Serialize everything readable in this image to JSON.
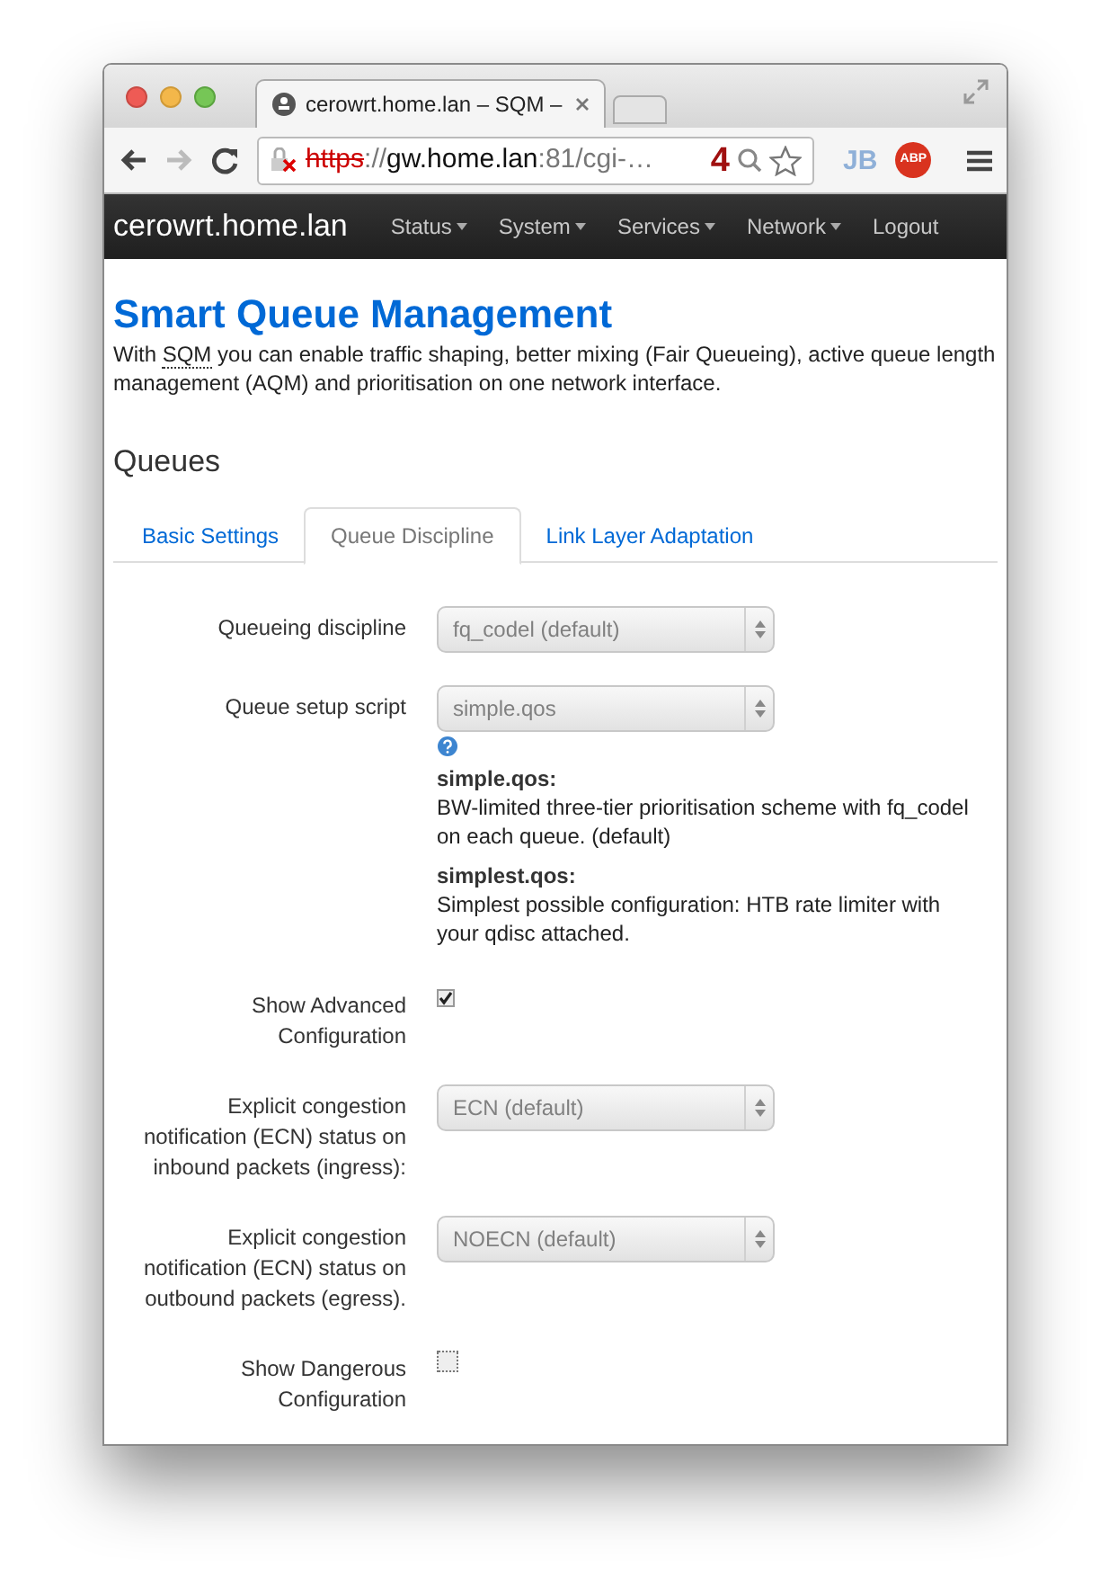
{
  "browser": {
    "tab_title": "cerowrt.home.lan – SQM –",
    "url": {
      "scheme": "https",
      "separator": "://",
      "host": "gw.home.lan",
      "path": ":81/cgi-…"
    },
    "badge": "4",
    "extensions": [
      {
        "kind": "jb",
        "label": "JB"
      },
      {
        "kind": "abp",
        "label": "ABP"
      }
    ]
  },
  "navbar": {
    "brand": "cerowrt.home.lan",
    "items": [
      {
        "label": "Status",
        "dropdown": true
      },
      {
        "label": "System",
        "dropdown": true
      },
      {
        "label": "Services",
        "dropdown": true
      },
      {
        "label": "Network",
        "dropdown": true
      },
      {
        "label": "Logout",
        "dropdown": false
      }
    ]
  },
  "page": {
    "title": "Smart Queue Management",
    "description": {
      "before": "With ",
      "abbr": "SQM",
      "after": " you can enable traffic shaping, better mixing (Fair Queueing), active queue length management (AQM) and prioritisation on one network interface."
    }
  },
  "section": {
    "title": "Queues",
    "tabs": [
      {
        "label": "Basic Settings",
        "selected": false
      },
      {
        "label": "Queue Discipline",
        "selected": true
      },
      {
        "label": "Link Layer Adaptation",
        "selected": false
      }
    ]
  },
  "fields": [
    {
      "kind": "select",
      "label": "Queueing discipline",
      "value": "fq_codel (default)"
    },
    {
      "kind": "select",
      "label": "Queue setup script",
      "value": "simple.qos",
      "help": [
        {
          "name": "simple.qos:",
          "text": "BW-limited three-tier prioritisation scheme with fq_codel on each queue. (default)"
        },
        {
          "name": "simplest.qos:",
          "text": "Simplest possible configuration: HTB rate limiter with your qdisc attached."
        }
      ]
    },
    {
      "kind": "checkbox",
      "label": "Show Advanced Configuration",
      "checked": true
    },
    {
      "kind": "select",
      "label": "Explicit congestion notification (ECN) status on inbound packets (ingress):",
      "value": "ECN (default)"
    },
    {
      "kind": "select",
      "label": "Explicit congestion notification (ECN) status on outbound packets (egress).",
      "value": "NOECN (default)"
    },
    {
      "kind": "checkbox",
      "label": "Show Dangerous Configuration",
      "checked": false
    }
  ]
}
